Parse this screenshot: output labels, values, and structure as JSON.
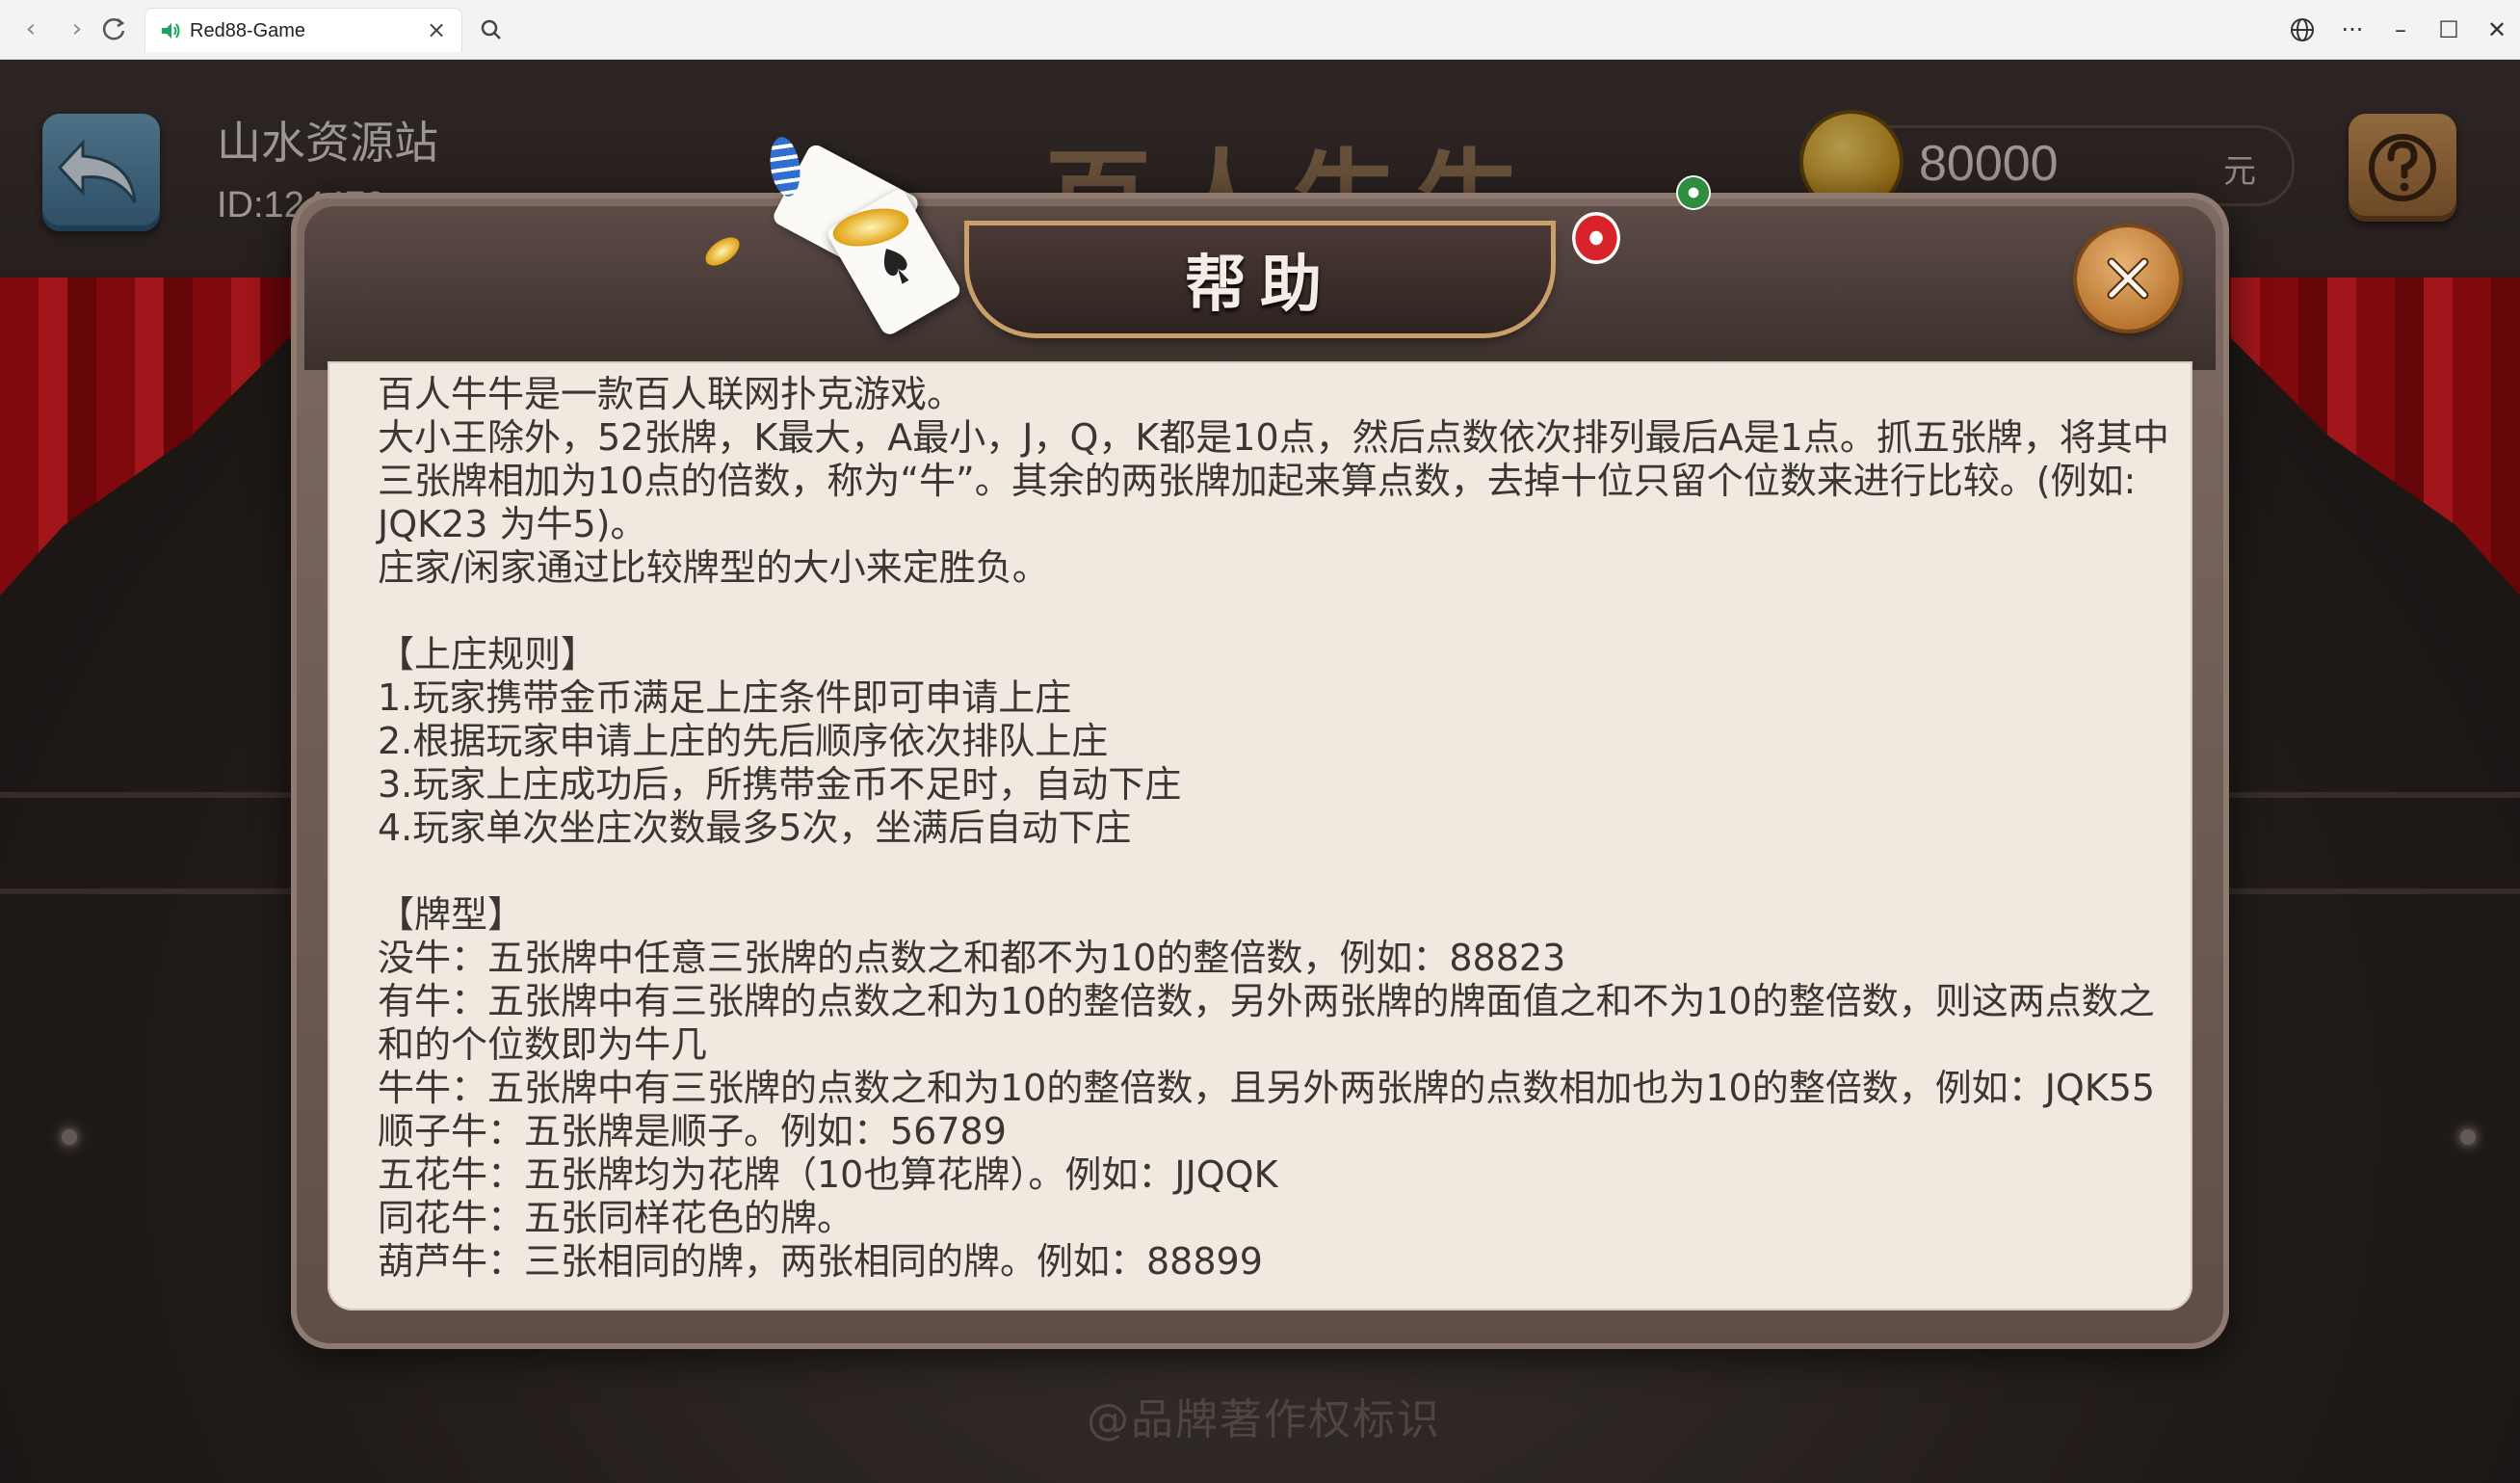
{
  "browser": {
    "tab_title": "Red88-Game",
    "icons": [
      "back-arrow-icon",
      "forward-arrow-icon",
      "reload-icon",
      "speaker-icon",
      "close-tab-icon",
      "search-icon",
      "globe-icon",
      "more-icon",
      "minimize-icon",
      "maximize-icon",
      "close-window-icon"
    ]
  },
  "game": {
    "player_name": "山水资源站",
    "player_id": "ID:124479",
    "title": "百人牛牛",
    "coins": "80000",
    "coin_unit": "元",
    "watermark": "@品牌著作权标识"
  },
  "dialog": {
    "title": "帮助",
    "lines": [
      "百人牛牛是一款百人联网扑克游戏。",
      "大小王除外，52张牌，K最大，A最小，J，Q，K都是10点，然后点数依次排列最后A是1点。抓五张牌，将其中三张牌相加为10点的倍数，称为“牛”。其余的两张牌加起来算点数，去掉十位只留个位数来进行比较。(例如: JQK23 为牛5)。",
      "庄家/闲家通过比较牌型的大小来定胜负。",
      "",
      "【上庄规则】",
      "1.玩家携带金币满足上庄条件即可申请上庄",
      "2.根据玩家申请上庄的先后顺序依次排队上庄",
      "3.玩家上庄成功后，所携带金币不足时，自动下庄",
      "4.玩家单次坐庄次数最多5次，坐满后自动下庄",
      "",
      "【牌型】",
      "没牛：五张牌中任意三张牌的点数之和都不为10的整倍数，例如：88823",
      "有牛：五张牌中有三张牌的点数之和为10的整倍数，另外两张牌的牌面值之和不为10的整倍数，则这两点数之和的个位数即为牛几",
      "牛牛：五张牌中有三张牌的点数之和为10的整倍数，且另外两张牌的点数相加也为10的整倍数，例如：JQK55",
      "顺子牛：五张牌是顺子。例如：56789",
      "五花牛：五张牌均为花牌（10也算花牌）。例如：JJQQK",
      "同花牛：五张同样花色的牌。",
      "葫芦牛：三张相同的牌，两张相同的牌。例如：88899"
    ]
  },
  "colors": {
    "panel_bg": "#efe9df",
    "text": "#3b3633",
    "accent_gold": "#c9a06a",
    "back_button": "#4f82a3",
    "help_button": "#b07a43"
  }
}
